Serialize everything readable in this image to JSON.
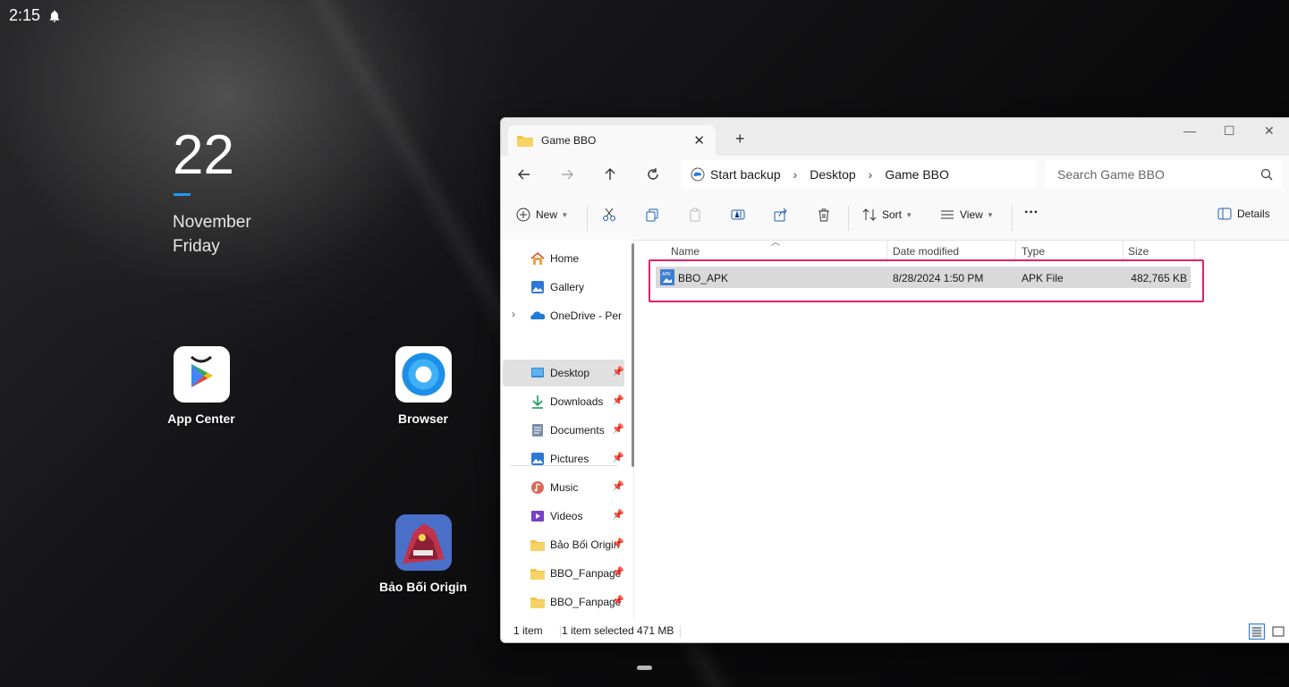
{
  "status": {
    "time": "2:15"
  },
  "clock": {
    "day": "22",
    "month": "November",
    "weekday": "Friday"
  },
  "desktop_apps": [
    {
      "label": "App Center"
    },
    {
      "label": "Browser"
    },
    {
      "label": "Bảo Bối Origin"
    }
  ],
  "explorer": {
    "tab_title": "Game BBO",
    "breadcrumb": [
      "Start backup",
      "Desktop",
      "Game BBO"
    ],
    "search_placeholder": "Search Game BBO",
    "toolbar": {
      "new": "New",
      "sort": "Sort",
      "view": "View",
      "more": "···",
      "details": "Details"
    },
    "sidebar": [
      {
        "label": "Home",
        "icon": "home-icon"
      },
      {
        "label": "Gallery",
        "icon": "gallery-icon"
      },
      {
        "label": "OneDrive - Personal",
        "icon": "onedrive-icon"
      },
      {
        "label": "Desktop",
        "icon": "desktop-icon",
        "pinned": true,
        "selected": true
      },
      {
        "label": "Downloads",
        "icon": "download-icon",
        "pinned": true
      },
      {
        "label": "Documents",
        "icon": "documents-icon",
        "pinned": true
      },
      {
        "label": "Pictures",
        "icon": "pictures-icon",
        "pinned": true
      },
      {
        "label": "Music",
        "icon": "music-icon",
        "pinned": true
      },
      {
        "label": "Videos",
        "icon": "videos-icon",
        "pinned": true
      },
      {
        "label": "Bảo Bối Origin",
        "icon": "folder-icon",
        "pinned": true
      },
      {
        "label": "BBO_Fanpage",
        "icon": "folder-icon",
        "pinned": true
      },
      {
        "label": "BBO_Fanpage",
        "icon": "folder-icon",
        "pinned": true
      }
    ],
    "columns": [
      "Name",
      "Date modified",
      "Type",
      "Size"
    ],
    "files": [
      {
        "name": "BBO_APK",
        "date": "8/28/2024 1:50 PM",
        "type": "APK File",
        "size": "482,765 KB"
      }
    ],
    "statusbar": {
      "count": "1 item",
      "selected": "1 item selected",
      "size": "471 MB"
    }
  },
  "colors": {
    "accent": "#1e9bf0",
    "highlight": "#e2206a"
  }
}
